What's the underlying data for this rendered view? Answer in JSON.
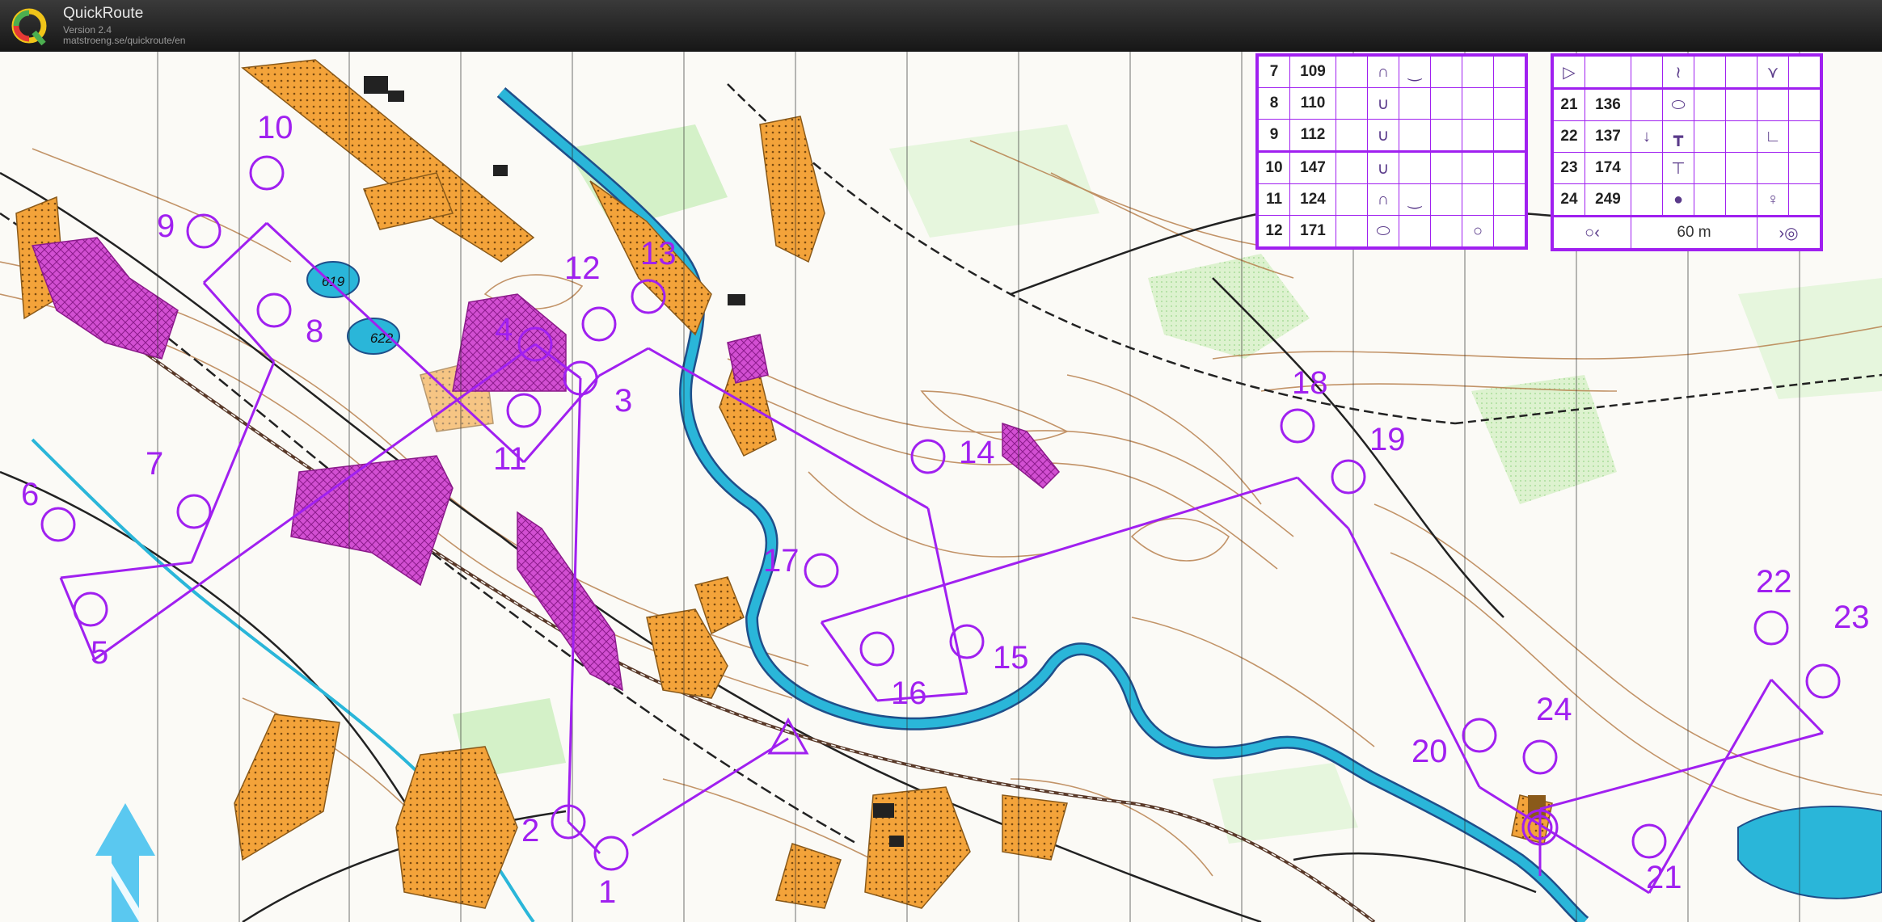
{
  "window": {
    "app_name": "QuickRoute",
    "version": "Version 2.4",
    "url": "matstroeng.se/quickroute/en",
    "logo_letter": "Q"
  },
  "colors": {
    "course": "#a020f0",
    "water": "#2ab6d9",
    "open_land": "#f3a33a",
    "forbidden": "#d24fd2",
    "contour": "#b47a45"
  },
  "map": {
    "lake_heights": [
      "619",
      "622"
    ],
    "north_arrow": "north-arrow"
  },
  "controls": [
    "1",
    "2",
    "3",
    "4",
    "5",
    "6",
    "7",
    "8",
    "9",
    "10",
    "11",
    "12",
    "13",
    "14",
    "15",
    "16",
    "17",
    "18",
    "19",
    "20",
    "21",
    "22",
    "23",
    "24"
  ],
  "descriptions_left": {
    "rows": [
      {
        "num": "7",
        "code": "109",
        "s1": "",
        "s2": "∩",
        "s3": "‿",
        "s4": "",
        "s5": ""
      },
      {
        "num": "8",
        "code": "110",
        "s1": "",
        "s2": "∪",
        "s3": "",
        "s4": "",
        "s5": ""
      },
      {
        "num": "9",
        "code": "112",
        "s1": "",
        "s2": "∪",
        "s3": "",
        "s4": "",
        "s5": ""
      },
      {
        "num": "10",
        "code": "147",
        "s1": "",
        "s2": "∪",
        "s3": "",
        "s4": "",
        "s5": ""
      },
      {
        "num": "11",
        "code": "124",
        "s1": "",
        "s2": "∩",
        "s3": "‿",
        "s4": "",
        "s5": ""
      },
      {
        "num": "12",
        "code": "171",
        "s1": "",
        "s2": "⬭",
        "s3": "",
        "s4": "",
        "s5": "○"
      }
    ]
  },
  "descriptions_right": {
    "top_row": {
      "s1": "▷",
      "s4": "≀",
      "s7": "⋎"
    },
    "rows": [
      {
        "num": "21",
        "code": "136",
        "s1": "",
        "s2": "⬭",
        "s3": "",
        "s4": "",
        "s5": ""
      },
      {
        "num": "22",
        "code": "137",
        "s1": "↓",
        "s2": "┳",
        "s3": "",
        "s4": "",
        "s5": "∟"
      },
      {
        "num": "23",
        "code": "174",
        "s1": "",
        "s2": "⊤",
        "s3": "",
        "s4": "",
        "s5": ""
      },
      {
        "num": "24",
        "code": "249",
        "s1": "",
        "s2": "●",
        "s3": "",
        "s4": "",
        "s5": "♀"
      }
    ],
    "finish": {
      "left": "○‹",
      "distance": "60 m",
      "right": "›◎"
    }
  }
}
